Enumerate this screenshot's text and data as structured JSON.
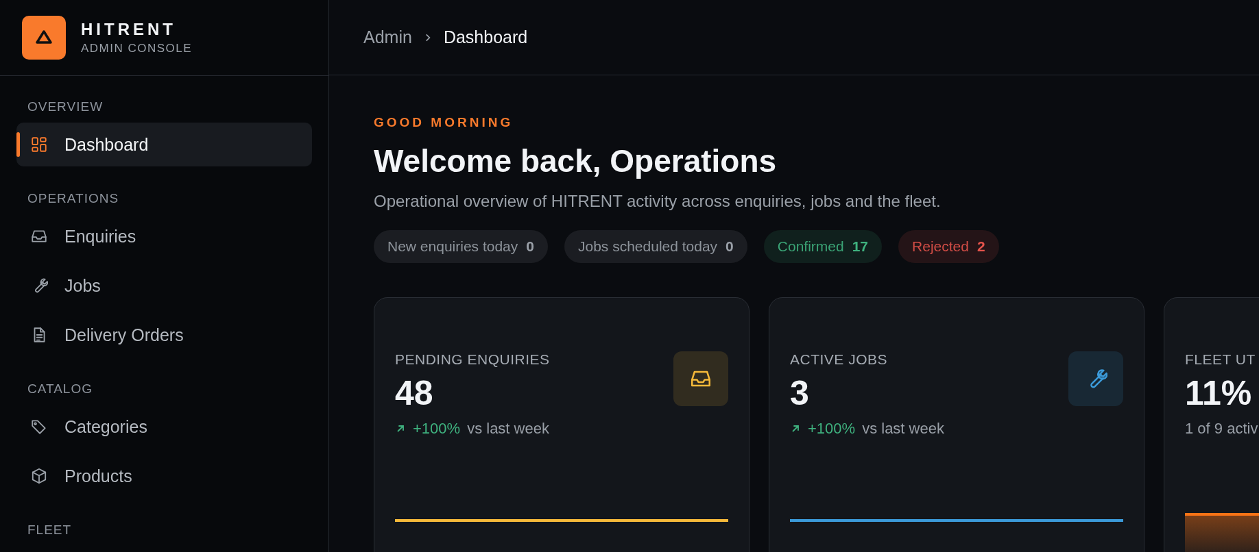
{
  "brand": {
    "name": "HITRENT",
    "subtitle": "ADMIN CONSOLE"
  },
  "sidebar": {
    "sections": [
      {
        "title": "OVERVIEW",
        "items": [
          {
            "label": "Dashboard",
            "kind": "grid",
            "selected": true
          }
        ]
      },
      {
        "title": "OPERATIONS",
        "items": [
          {
            "label": "Enquiries",
            "kind": "inbox",
            "selected": false
          },
          {
            "label": "Jobs",
            "kind": "wrench",
            "selected": false
          },
          {
            "label": "Delivery Orders",
            "kind": "document",
            "selected": false
          }
        ]
      },
      {
        "title": "CATALOG",
        "items": [
          {
            "label": "Categories",
            "kind": "tag",
            "selected": false
          },
          {
            "label": "Products",
            "kind": "box",
            "selected": false
          }
        ]
      },
      {
        "title": "FLEET"
      }
    ]
  },
  "breadcrumb": [
    "Admin",
    "Dashboard"
  ],
  "greeting": "GOOD MORNING",
  "heading": "Welcome back, Operations",
  "description": "Operational overview of HITRENT activity across enquiries, jobs and the fleet.",
  "chips": [
    {
      "label": "New enquiries today",
      "count": "0",
      "color": "#9aa0a8"
    },
    {
      "label": "Jobs scheduled today",
      "count": "0",
      "color": "#9aa0a8"
    },
    {
      "label": "Confirmed",
      "count": "17",
      "color": "#3fb27f"
    },
    {
      "label": "Rejected",
      "count": "2",
      "color": "#e5534b"
    }
  ],
  "cards": [
    {
      "label": "PENDING ENQUIRIES",
      "value": "48",
      "trend": "+100%",
      "trend_note": "vs last week",
      "kind": "line",
      "color": "#f5b93a"
    },
    {
      "label": "ACTIVE JOBS",
      "value": "3",
      "trend": "+100%",
      "trend_note": "vs last week",
      "kind": "line",
      "color": "#3b9ad9"
    },
    {
      "label": "FLEET UT",
      "value": "11%",
      "note": "1 of 9 activ",
      "kind": "area",
      "color": "#f97316"
    }
  ]
}
